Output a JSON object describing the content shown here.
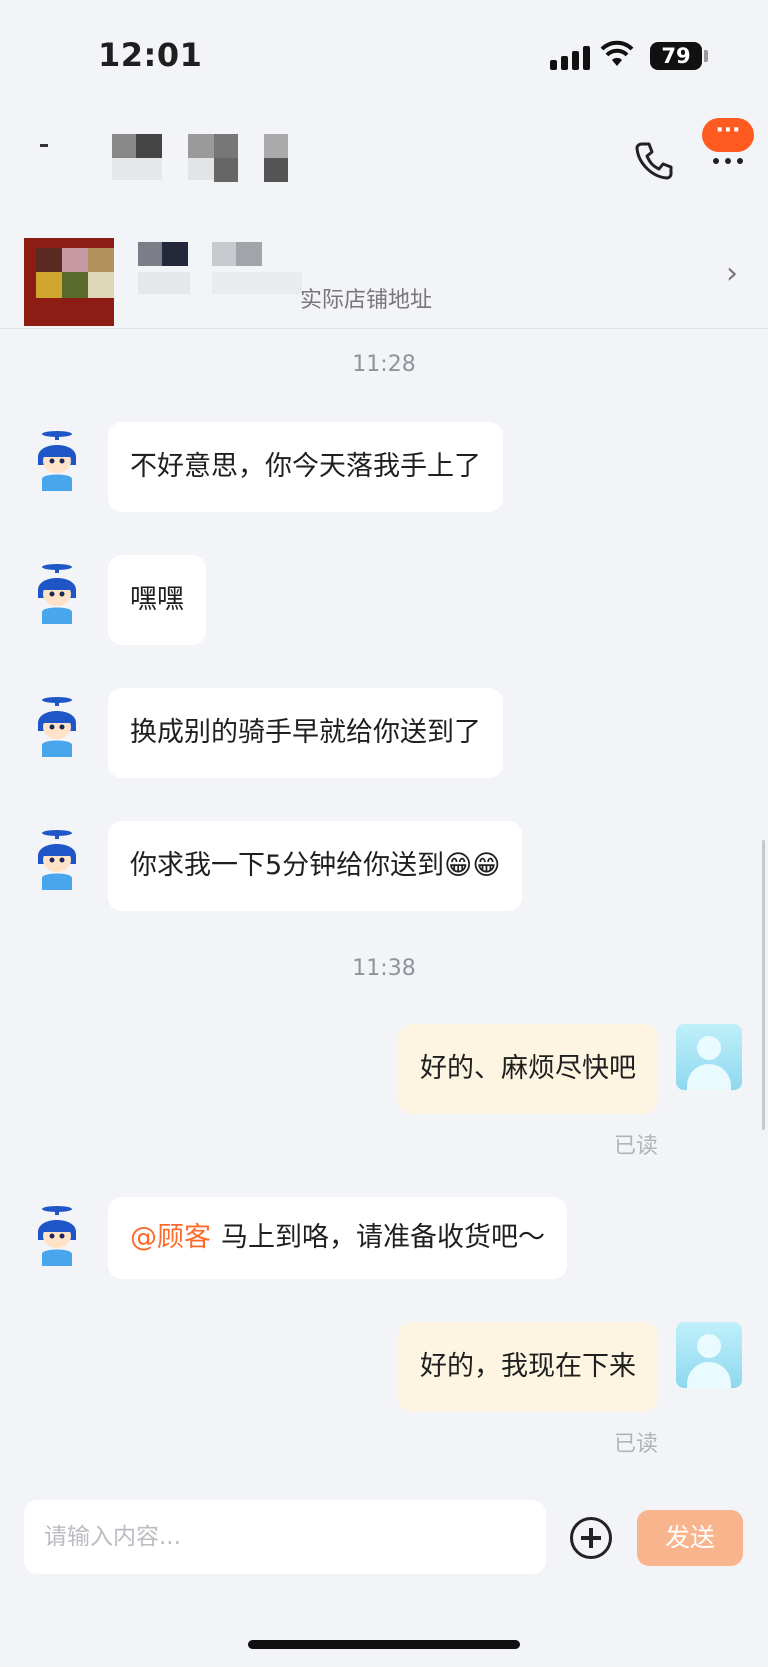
{
  "status_bar": {
    "time": "12:01",
    "battery": "79"
  },
  "header": {
    "call_icon": "phone-icon",
    "more_icon": "more-dots-icon",
    "more_badge": "···"
  },
  "store": {
    "subtitle": "实际店铺地址",
    "chevron": "›"
  },
  "messages": [
    {
      "type": "time",
      "text": "11:28"
    },
    {
      "type": "in",
      "text": "不好意思，你今天落我手上了"
    },
    {
      "type": "in",
      "text": "嘿嘿"
    },
    {
      "type": "in",
      "text": "换成别的骑手早就给你送到了"
    },
    {
      "type": "in",
      "text": "你求我一下5分钟给你送到😁😁"
    },
    {
      "type": "time",
      "text": "11:38"
    },
    {
      "type": "out",
      "text": "好的、麻烦尽快吧",
      "status": "已读"
    },
    {
      "type": "in",
      "mention": "@顾客",
      "text": "马上到咯，请准备收货吧～"
    },
    {
      "type": "out",
      "text": "好的，我现在下来",
      "status": "已读"
    }
  ],
  "composer": {
    "placeholder": "请输入内容...",
    "send_label": "发送",
    "add_icon": "plus-circle-icon"
  },
  "colors": {
    "accent": "#ff5a1f",
    "mention": "#ff6a2b",
    "send_button": "#f8b48c",
    "my_bubble": "#fdf4e2"
  }
}
